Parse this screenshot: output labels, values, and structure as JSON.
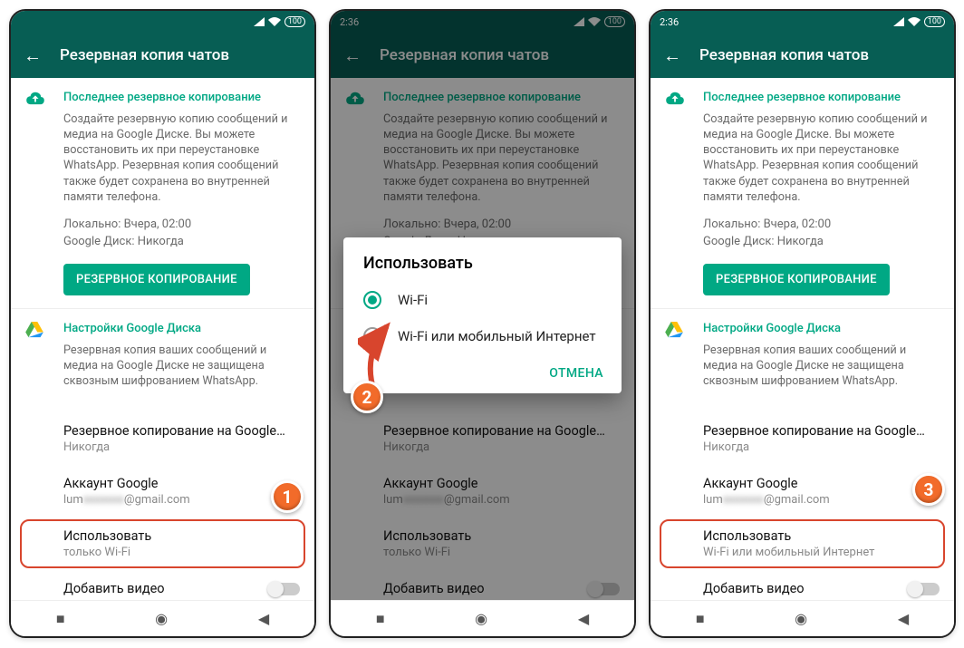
{
  "statusbar": {
    "time": "2:36",
    "battery": "100"
  },
  "appbar": {
    "title": "Резервная копия чатов"
  },
  "backup": {
    "title": "Последнее резервное копирование",
    "desc": "Создайте резервную копию сообщений и медиа на Google Диске. Вы можете восстановить их при переустановке WhatsApp. Резервная копия сообщений также будет сохранена во внутренней памяти телефона.",
    "local_label": "Локально: Вчера, 02:00",
    "gdrive_label": "Google Диск: Никогда",
    "button": "РЕЗЕРВНОЕ КОПИРОВАНИЕ"
  },
  "gdrive": {
    "title": "Настройки Google Диска",
    "desc": "Резервная копия ваших сообщений и медиа на Google Диске не защищена сквозным шифрованием WhatsApp."
  },
  "items": {
    "backup_to": {
      "primary": "Резервное копирование на Google…",
      "secondary": "Никогда"
    },
    "account": {
      "primary": "Аккаунт Google",
      "secondary_prefix": "lum",
      "secondary_suffix": "@gmail.com"
    },
    "use": {
      "primary": "Использовать",
      "secondary_wifi": "только Wi-Fi",
      "secondary_both": "Wi-Fi или мобильный Интернет"
    },
    "add_video": "Добавить видео"
  },
  "dialog": {
    "title": "Использовать",
    "opt_wifi": "Wi-Fi",
    "opt_both": "Wi-Fi или мобильный Интернет",
    "cancel": "ОТМЕНА"
  },
  "badges": {
    "b1": "1",
    "b2": "2",
    "b3": "3"
  }
}
